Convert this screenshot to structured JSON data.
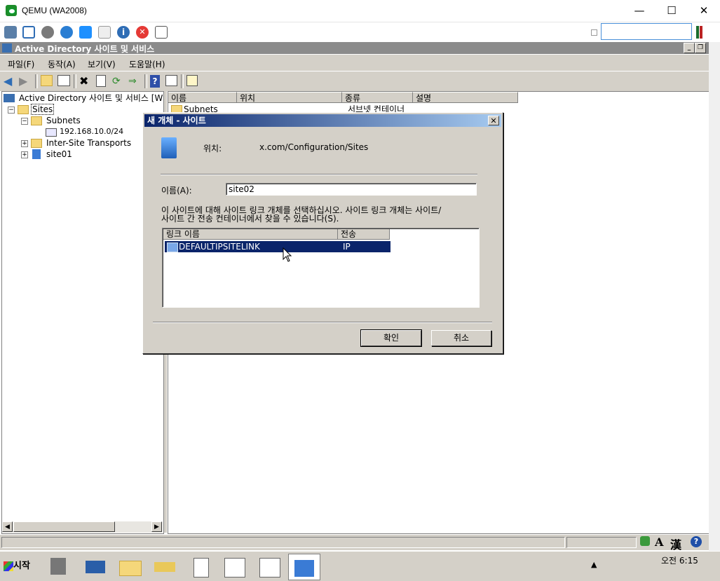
{
  "qemu": {
    "title": "QEMU (WA2008)"
  },
  "mmc": {
    "title": "Active Directory 사이트 및 서비스",
    "menu": [
      "파일(F)",
      "동작(A)",
      "보기(V)",
      "도움말(H)"
    ]
  },
  "tree": {
    "root": "Active Directory 사이트 및 서비스 [W",
    "sites": "Sites",
    "subnets": "Subnets",
    "subnet_item": "192.168.10.0/24",
    "inter_site": "Inter-Site Transports",
    "site01": "site01"
  },
  "list": {
    "columns": [
      "이름",
      "위치",
      "종류",
      "설명"
    ],
    "rows": [
      {
        "name": "Subnets",
        "type": "서브넷 컨테이너"
      }
    ]
  },
  "dialog": {
    "title": "새 개체 - 사이트",
    "location_label": "위치:",
    "location_value": "x.com/Configuration/Sites",
    "name_label": "이름(A):",
    "name_value": "site02",
    "instruction_line1": "이 사이트에 대해 사이트 링크 개체를 선택하십시오. 사이트 링크 개체는 사이트/",
    "instruction_line2": "사이트 간 전송 컨테이너에서 찾을 수 있습니다(S).",
    "link_columns": [
      "링크 이름",
      "전송"
    ],
    "links": [
      {
        "name": "DEFAULTIPSITELINK",
        "transport": "IP"
      }
    ],
    "ok_label": "확인",
    "cancel_label": "취소"
  },
  "taskbar": {
    "start_label": "시작",
    "clock_time": "오전 6:15"
  },
  "ime": {
    "mode": "A",
    "hanja": "漢"
  }
}
